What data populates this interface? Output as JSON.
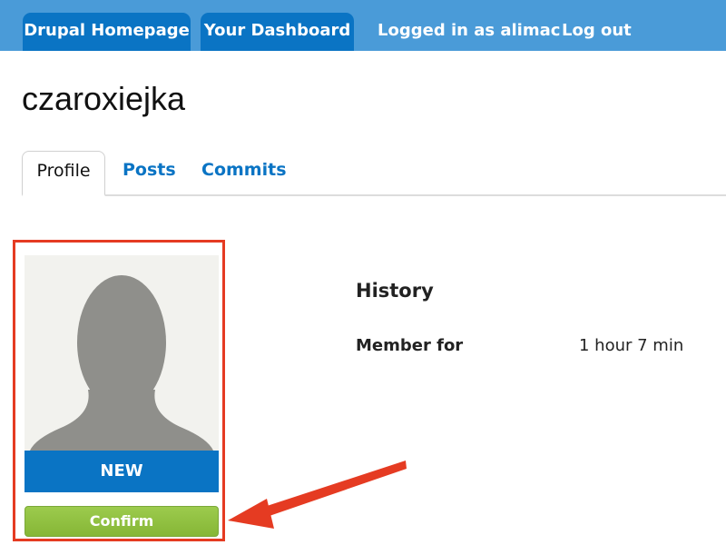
{
  "topbar": {
    "tabs": [
      {
        "label": "Drupal Homepage"
      },
      {
        "label": "Your Dashboard"
      }
    ],
    "user_status": "Logged in as alimac",
    "logout_label": "Log out"
  },
  "profile": {
    "username": "czaroxiejka",
    "tabs": [
      {
        "label": "Profile",
        "active": true
      },
      {
        "label": "Posts",
        "active": false
      },
      {
        "label": "Commits",
        "active": false
      }
    ],
    "badge_label": "NEW",
    "confirm_label": "Confirm",
    "history": {
      "title": "History",
      "member_for_label": "Member for",
      "member_for_value": "1 hour 7 min"
    }
  },
  "icons": {
    "avatar": "default-user-silhouette",
    "annotation": "red-arrow"
  },
  "colors": {
    "topbar": "#4a9bd8",
    "tab_accent": "#0a74c4",
    "confirm": "#8fbf3f",
    "highlight": "#e53b22",
    "link": "#0a74c4"
  }
}
